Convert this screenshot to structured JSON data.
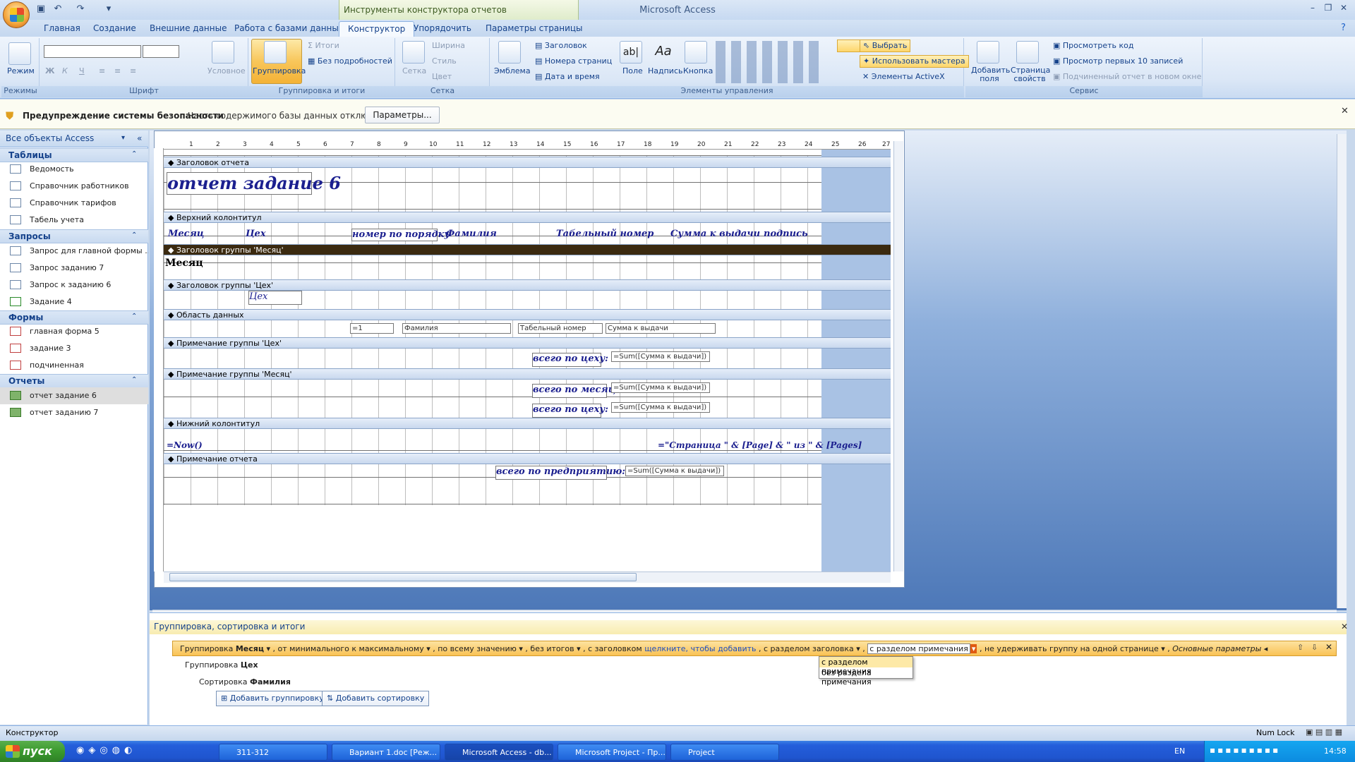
{
  "app_title": "Microsoft Access",
  "tools_title": "Инструменты конструктора отчетов",
  "tabs": [
    "Главная",
    "Создание",
    "Внешние данные",
    "Работа с базами данных",
    "Конструктор",
    "Упорядочить",
    "Параметры страницы"
  ],
  "ribbon": {
    "modes": {
      "button": "Режим",
      "label": "Режимы"
    },
    "font": {
      "label": "Шрифт",
      "conditional": "Условное"
    },
    "grouping": {
      "button": "Группировка",
      "totals": "Итоги",
      "no_details": "Без подробностей",
      "label": "Группировка и итоги"
    },
    "grid": {
      "button": "Сетка",
      "width": "Ширина",
      "style": "Стиль",
      "color": "Цвет",
      "label": "Сетка"
    },
    "controls": {
      "emblem": "Эмблема",
      "header": "Заголовок",
      "page_numbers": "Номера страниц",
      "date_time": "Дата и время",
      "field": "Поле",
      "label_ctl": "Надпись",
      "button": "Кнопка",
      "label": "Элементы управления",
      "select": "Выбрать",
      "use_wizard": "Использовать мастера",
      "activex": "Элементы ActiveX"
    },
    "tools": {
      "add_fields": "Добавить поля",
      "property_sheet": "Страница свойств",
      "view_code": "Просмотреть код",
      "view_top10": "Просмотр первых 10 записей",
      "subreport": "Подчиненный отчет в новом окне",
      "label": "Сервис"
    }
  },
  "security": {
    "title": "Предупреждение системы безопасности",
    "message": "Часть содержимого базы данных отключено",
    "button": "Параметры..."
  },
  "nav": {
    "header": "Все объекты Access",
    "sections": [
      {
        "title": "Таблицы",
        "items": [
          "Ведомость",
          "Справочник работников",
          "Справочник тарифов",
          "Табель учета"
        ]
      },
      {
        "title": "Запросы",
        "items": [
          "Запрос для главной формы ...",
          "Запрос заданию 7",
          "Запрос к заданию 6",
          "Задание 4"
        ]
      },
      {
        "title": "Формы",
        "items": [
          "главная форма 5",
          "задание 3",
          "подчиненная"
        ]
      },
      {
        "title": "Отчеты",
        "items": [
          "отчет задание 6",
          "отчет заданию 7"
        ]
      }
    ]
  },
  "report": {
    "ruler": [
      "1",
      "2",
      "3",
      "4",
      "5",
      "6",
      "7",
      "8",
      "9",
      "10",
      "11",
      "12",
      "13",
      "14",
      "15",
      "16",
      "17",
      "18",
      "19",
      "20",
      "21",
      "22",
      "23",
      "24",
      "25",
      "26",
      "27"
    ],
    "sections": {
      "report_header": "Заголовок отчета",
      "page_header": "Верхний колонтитул",
      "group_month_header": "Заголовок группы 'Месяц'",
      "group_ceh_header": "Заголовок группы 'Цех'",
      "detail": "Область данных",
      "group_ceh_footer": "Примечание группы 'Цех'",
      "group_month_footer": "Примечание группы 'Месяц'",
      "page_footer": "Нижний колонтитул",
      "report_footer": "Примечание отчета"
    },
    "title": "отчет задание 6",
    "headers": [
      "Месяц",
      "Цех",
      "номер по порядку",
      "Фамилия",
      "Табельный номер",
      "Сумма к выдачи",
      "подпись"
    ],
    "group_month": "Месяц",
    "group_ceh": "Цех",
    "detail_fields": [
      "=1",
      "Фамилия",
      "Табельный номер",
      "Сумма к выдачи"
    ],
    "ceh_total_label": "всего по цеху:",
    "sum_expr": "=Sum([Сумма к выдачи])",
    "month_total_label": "всего по месяц:",
    "now_expr": "=Now()",
    "page_expr": "=\"Страница \" & [Page] & \" из \" & [Pages]",
    "report_total_label": "всего по предприятию:"
  },
  "grouping_pane": {
    "title": "Группировка, сортировка и итоги",
    "bar": {
      "group": "Группировка",
      "field": "Месяц",
      "order": "от минимального к максимальному",
      "value": "по всему значению",
      "totals": "без итогов",
      "header": "с заголовком",
      "header_link": "щелкните, чтобы добавить",
      "header_section": "с разделом заголовка",
      "footer_section": "с разделом примечания",
      "keep": "не удерживать группу на одной странице",
      "more": "Основные параметры"
    },
    "dropdown": [
      "с разделом примечания",
      "без раздела примечания"
    ],
    "group2": {
      "label": "Группировка",
      "field": "Цех"
    },
    "sort": {
      "label": "Сортировка",
      "field": "Фамилия"
    },
    "add_group": "Добавить группировку",
    "add_sort": "Добавить сортировку"
  },
  "status": {
    "mode": "Конструктор",
    "numlock": "Num Lock"
  },
  "taskbar": {
    "start": "пуск",
    "tasks": [
      "311-312",
      "Вариант 1.doc [Реж...",
      "Microsoft Access - db...",
      "Microsoft Project - Пр...",
      "Project"
    ],
    "lang": "EN",
    "clock": "14:58"
  },
  "colors": {
    "accent": "#15428b",
    "group_header_band": "#3b2a10",
    "selection": "#f9c255"
  }
}
